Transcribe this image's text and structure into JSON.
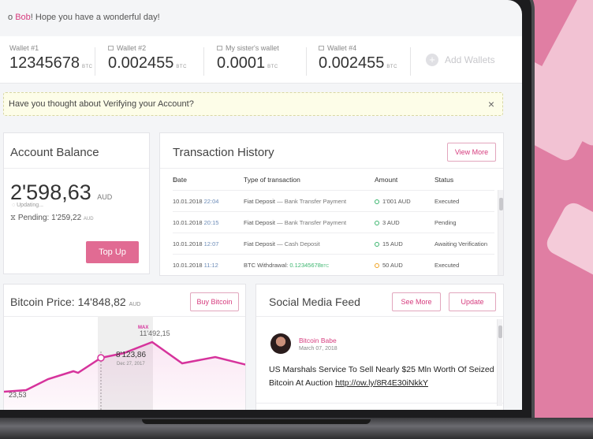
{
  "greeting": {
    "prefix": "o ",
    "name": "Bob",
    "suffix": "! Hope you have a wonderful day!"
  },
  "wallets": [
    {
      "label": "Wallet #1",
      "value": "12345678",
      "unit": "BTC"
    },
    {
      "label": "Wallet #2",
      "value": "0.002455",
      "unit": "BTC"
    },
    {
      "label": "My sister's wallet",
      "value": "0.0001",
      "unit": "BTC"
    },
    {
      "label": "Wallet #4",
      "value": "0.002455",
      "unit": "BTC"
    }
  ],
  "add_wallets": "Add Wallets",
  "verify_banner": {
    "text": "Have you thought about Verifying your Account?",
    "close": "×"
  },
  "balance": {
    "title": "Account Balance",
    "amount": "2'598,63",
    "unit": "AUD",
    "updating": "Updating...",
    "pending_label": "Pending:",
    "pending_value": "1'259,22",
    "pending_unit": "AUD",
    "topup": "Top Up"
  },
  "transactions": {
    "title": "Transaction History",
    "view_more": "View More",
    "columns": [
      "Date",
      "Type of transaction",
      "Amount",
      "Status"
    ],
    "rows": [
      {
        "date": "10.01.2018",
        "time": "22:04",
        "type": "Fiat Deposit",
        "detail": " — Bank Transfer Payment",
        "amount": "1'001 AUD",
        "status": "Executed",
        "dot": "green"
      },
      {
        "date": "10.01.2018",
        "time": "20:15",
        "type": "Fiat Deposit",
        "detail": " — Bank Transfer Payment",
        "amount": "3 AUD",
        "status": "Pending",
        "dot": "green"
      },
      {
        "date": "10.01.2018",
        "time": "12:07",
        "type": "Fiat Deposit",
        "detail": " — Cash Deposit",
        "amount": "15 AUD",
        "status": "Awaiting Verification",
        "dot": "green"
      },
      {
        "date": "10.01.2018",
        "time": "11:12",
        "type": "BTC Withdrawal:",
        "detail": " 0.12345678",
        "detail_suffix": "BTC",
        "amount": "50 AUD",
        "status": "Executed",
        "dot": "orange"
      }
    ]
  },
  "bitcoin": {
    "title": "Bitcoin Price:",
    "price": "14'848,82",
    "unit": "AUD",
    "buy": "Buy Bitcoin",
    "max_label": "MAX",
    "max_value": "11'492,15",
    "point_value": "8'123,86",
    "point_date": "Dec 27, 2017",
    "left_value": "23,53",
    "line_color": "#d6339c"
  },
  "social": {
    "title": "Social Media Feed",
    "see_more": "See More",
    "update": "Update",
    "post": {
      "author": "Bitcoin Babe",
      "date": "March 07, 2018",
      "text": "US Marshals Service To Sell Nearly $25 Mln Worth Of Seized Bitcoin At Auction ",
      "link": "http://ow.ly/8R4E30iNkkY"
    }
  }
}
